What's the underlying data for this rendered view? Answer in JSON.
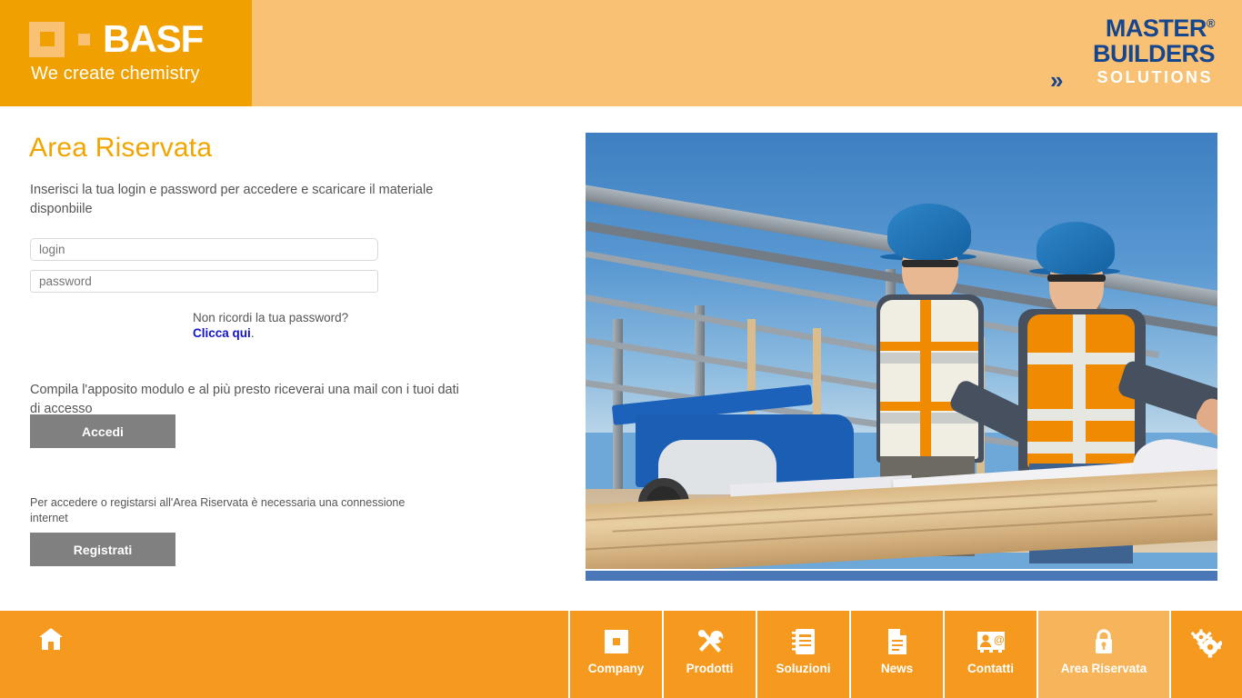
{
  "header": {
    "brand": {
      "name": "BASF",
      "tagline": "We create chemistry",
      "logo_icon": "basf-square-logo",
      "block_color": "#f0a000",
      "band_color": "#f9c173"
    },
    "partner_logo": {
      "line1": "MASTER",
      "registered": "®",
      "line2": "BUILDERS",
      "line3": "SOLUTIONS",
      "chevrons": "»",
      "color": "#15468e",
      "solutions_color": "#ffffff"
    }
  },
  "main": {
    "title": "Area Riservata",
    "title_color": "#f0a500",
    "intro": "Inserisci la tua login e password per accedere e scaricare il materiale disponbiile",
    "login_field": {
      "value": "",
      "placeholder": "login"
    },
    "password_field": {
      "value": "",
      "placeholder": "password"
    },
    "accedi_label": "Accedi",
    "forgot_question": "Non ricordi la tua password?",
    "forgot_link": "Clicca qui",
    "forgot_period": ".",
    "forgot_link_color": "#1414cf",
    "register_text": "Compila l'apposito modulo e al più presto riceverai una mail con i tuoi dati di accesso",
    "registrati_label": "Registrati",
    "notice_text": "Per accedere o registarsi all'Area Riservata è necessaria una connessione internet",
    "button_color": "#808080"
  },
  "photo": {
    "alt": "Two construction workers in blue hard hats and hi-vis vests reviewing blueprints on a timber beam at a steel-frame building site",
    "bottom_bar_color": "#4a77b8"
  },
  "bottomnav": {
    "background": "#f59a1e",
    "active_background": "#f7b55b",
    "home_icon": "home-icon",
    "settings_icon": "gears-icon",
    "items": [
      {
        "label": "Company",
        "icon": "square-logo-icon",
        "active": false
      },
      {
        "label": "Prodotti",
        "icon": "tools-icon",
        "active": false
      },
      {
        "label": "Soluzioni",
        "icon": "notebook-icon",
        "active": false
      },
      {
        "label": "News",
        "icon": "document-icon",
        "active": false
      },
      {
        "label": "Contatti",
        "icon": "contact-card-icon",
        "active": false
      },
      {
        "label": "Area Riservata",
        "icon": "lock-icon",
        "active": true
      }
    ]
  }
}
